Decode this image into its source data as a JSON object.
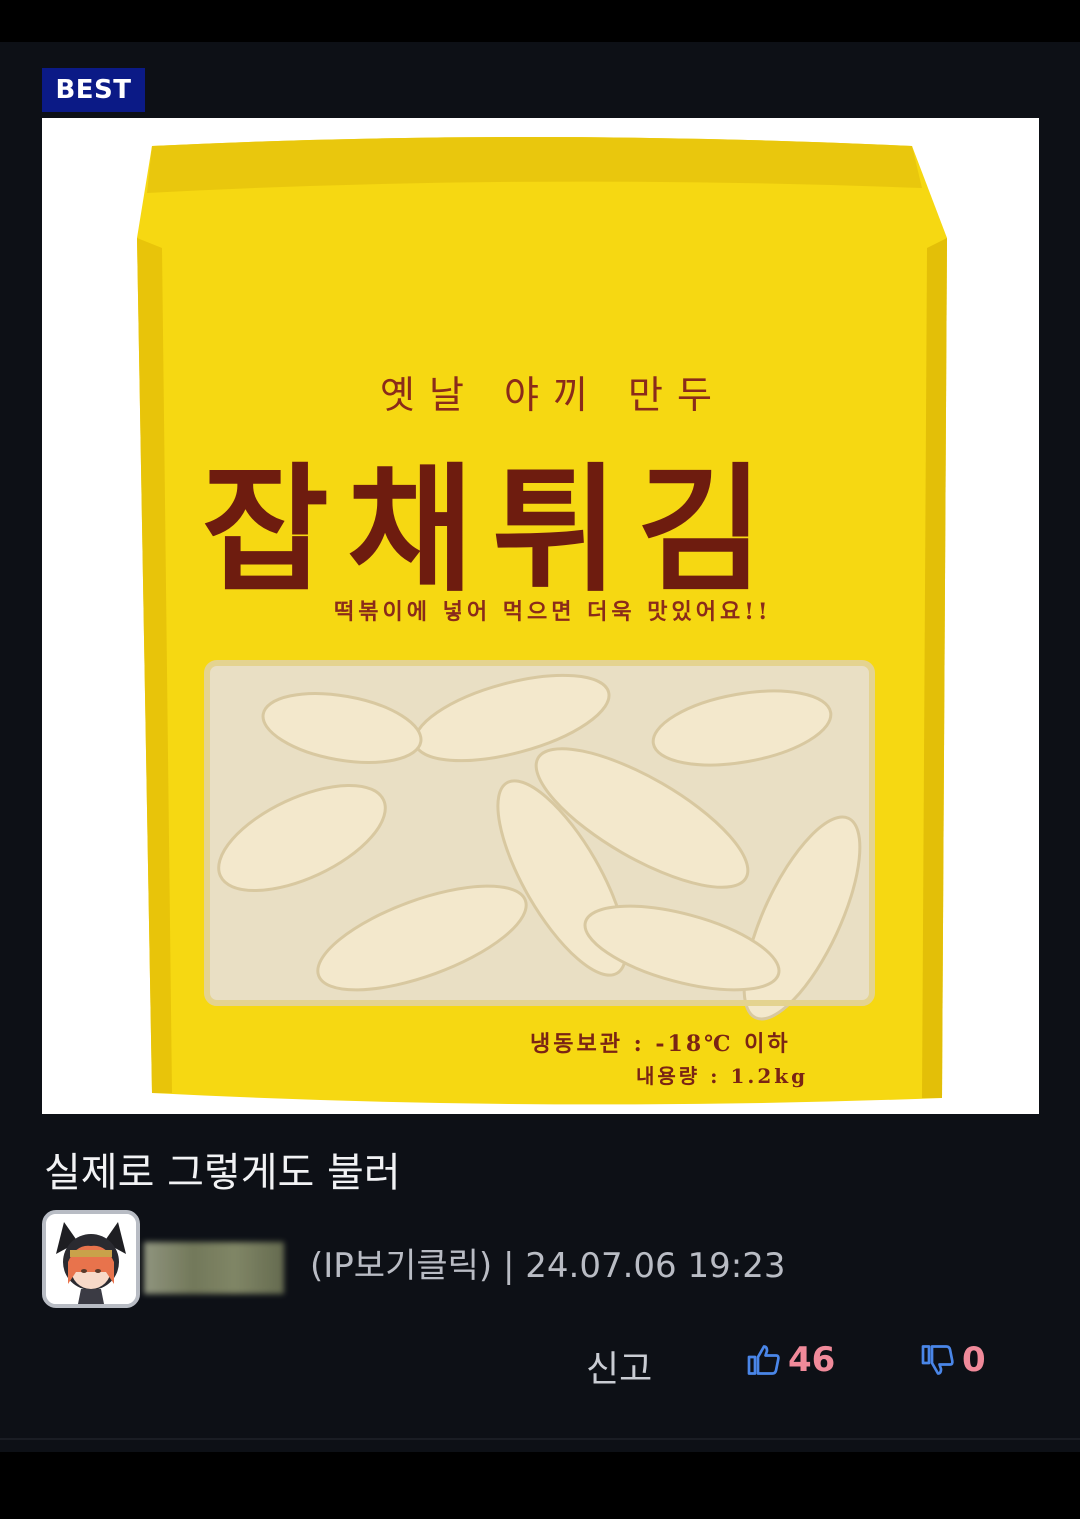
{
  "badge": "BEST",
  "post": {
    "title": "실제로 그렇게도 불러"
  },
  "photo": {
    "subtitle": "옛날 야끼 만두",
    "product_name": "잡채튀김",
    "tagline": "떡볶이에 넣어 먹으면 더욱 맛있어요!!",
    "storage": "냉동보관 : -18℃ 이하",
    "weight": "내용량 : 1.2kg"
  },
  "author": {
    "ip_link": "(IP보기클릭)",
    "separator": " | ",
    "timestamp": "24.07.06 19:23"
  },
  "actions": {
    "report_label": "신고",
    "like_count": "46",
    "dislike_count": "0",
    "like_icon": "thumbs-up-icon",
    "dislike_icon": "thumbs-down-icon"
  },
  "colors": {
    "background": "#0d1016",
    "badge": "#0b1a86",
    "vote": "#f08a9a",
    "icon": "#4a86e8"
  }
}
